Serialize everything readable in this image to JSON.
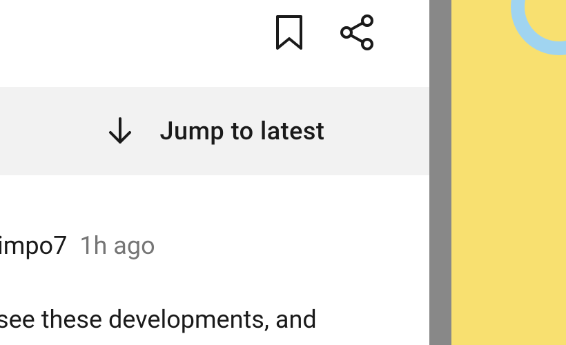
{
  "actions": {
    "bookmark": "bookmark",
    "share": "share"
  },
  "jump": {
    "label": "Jump to latest"
  },
  "post": {
    "username": "impo7",
    "timestamp": "1h ago",
    "snippet": "see these developments, and"
  }
}
